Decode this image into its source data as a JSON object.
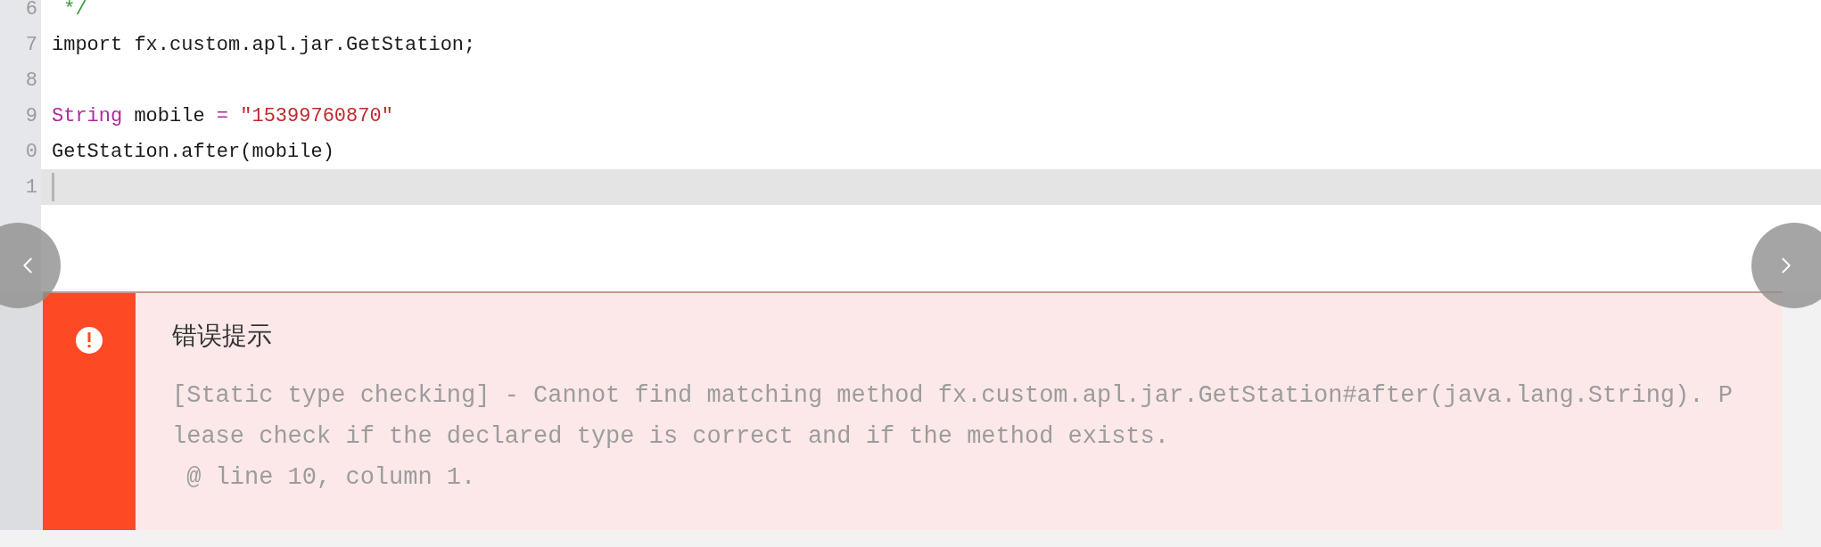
{
  "editor": {
    "lines": [
      {
        "number": "6",
        "active": false,
        "tokens": [
          {
            "kind": "comment",
            "text": " */"
          }
        ]
      },
      {
        "number": "7",
        "active": false,
        "tokens": [
          {
            "kind": "plain",
            "text": "import fx.custom.apl.jar.GetStation;"
          }
        ]
      },
      {
        "number": "8",
        "active": false
      },
      {
        "number": "9",
        "active": false,
        "tokens": [
          {
            "kind": "keyword",
            "text": "String"
          },
          {
            "kind": "plain",
            "text": " mobile "
          },
          {
            "kind": "operator",
            "text": "="
          },
          {
            "kind": "string",
            "text": " \"15399760870\""
          }
        ]
      },
      {
        "number": "0",
        "active": false,
        "tokens": [
          {
            "kind": "plain",
            "text": "GetStation.after(mobile)"
          }
        ]
      },
      {
        "number": "1",
        "active": true
      }
    ]
  },
  "error": {
    "title": "错误提示",
    "lines": [
      "[Static type checking] - Cannot find matching method fx.custom.apl.jar.GetStation#after(java.lang.String). P",
      "lease check if the declared type is correct and if the method exists.",
      " @ line 10, column 1."
    ]
  }
}
